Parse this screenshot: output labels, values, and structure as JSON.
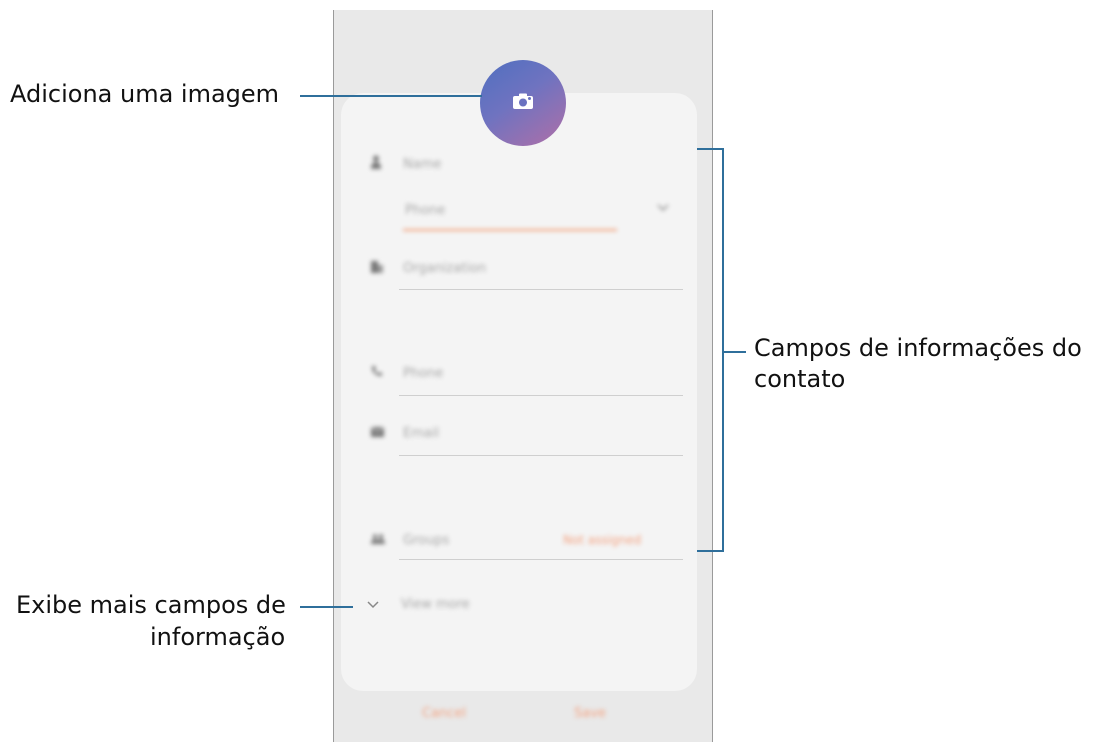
{
  "callouts": {
    "add_image": "Adiciona uma imagem",
    "info_fields_line1": "Campos de informações do",
    "info_fields_line2": "contato",
    "more_fields_line1": "Exibe mais campos de",
    "more_fields_line2": "informação"
  },
  "form": {
    "name_label": "Name",
    "storage_value": "Phone",
    "org_label": "Organization",
    "phone_label": "Phone",
    "email_label": "Email",
    "groups_label": "Groups",
    "groups_action": "Not assigned",
    "view_more": "View more"
  },
  "footer": {
    "cancel": "Cancel",
    "save": "Save"
  },
  "icons": {
    "avatar": "camera-icon",
    "name": "person-icon",
    "org": "building-icon",
    "phone": "phone-icon",
    "email": "email-icon",
    "groups": "groups-icon",
    "expand": "chevron-down-icon"
  },
  "colors": {
    "accent": "#f2a27c",
    "callout_line": "#2f6f9b",
    "avatar_start": "#4f6fbf",
    "avatar_end": "#b06fa7"
  }
}
